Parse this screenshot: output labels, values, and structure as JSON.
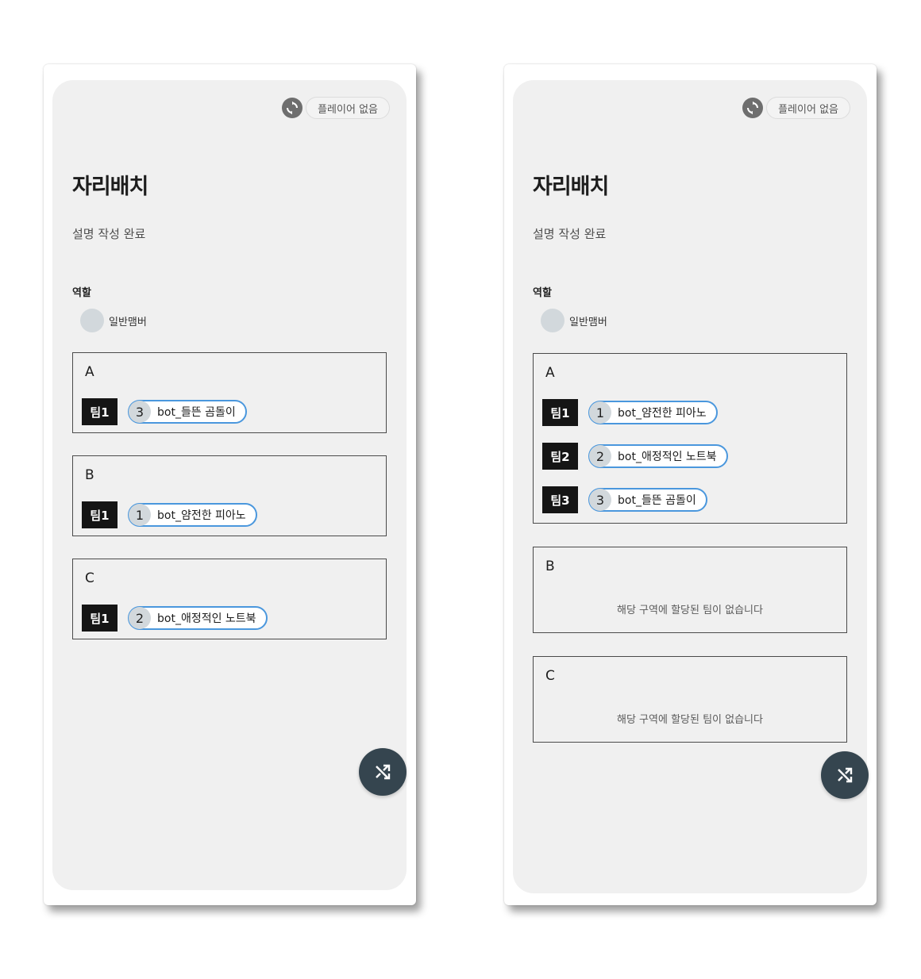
{
  "left": {
    "player_status": "플레이어 없음",
    "title": "자리배치",
    "description": "설명 작성 완료",
    "role_label": "역할",
    "roles": [
      "일반맴버"
    ],
    "zones": [
      {
        "name": "A",
        "teams": [
          {
            "tag": "팀1",
            "num": "3",
            "player": "bot_들뜬 곰돌이"
          }
        ]
      },
      {
        "name": "B",
        "teams": [
          {
            "tag": "팀1",
            "num": "1",
            "player": "bot_얌전한 피아노"
          }
        ]
      },
      {
        "name": "C",
        "teams": [
          {
            "tag": "팀1",
            "num": "2",
            "player": "bot_애정적인 노트북"
          }
        ]
      }
    ]
  },
  "right": {
    "player_status": "플레이어 없음",
    "title": "자리배치",
    "description": "설명 작성 완료",
    "role_label": "역할",
    "roles": [
      "일반맴버"
    ],
    "zones": [
      {
        "name": "A",
        "teams": [
          {
            "tag": "팀1",
            "num": "1",
            "player": "bot_얌전한 피아노"
          },
          {
            "tag": "팀2",
            "num": "2",
            "player": "bot_애정적인 노트북"
          },
          {
            "tag": "팀3",
            "num": "3",
            "player": "bot_들뜬 곰돌이"
          }
        ]
      },
      {
        "name": "B",
        "empty_message": "해당 구역에 할당된 팀이 없습니다"
      },
      {
        "name": "C",
        "empty_message": "해당 구역에 할당된 팀이 없습니다"
      }
    ]
  },
  "icons": {
    "refresh": "refresh-icon",
    "shuffle": "shuffle-icon"
  },
  "colors": {
    "accent": "#4a97dd",
    "fab": "#35454f",
    "team_tag": "#151515"
  }
}
